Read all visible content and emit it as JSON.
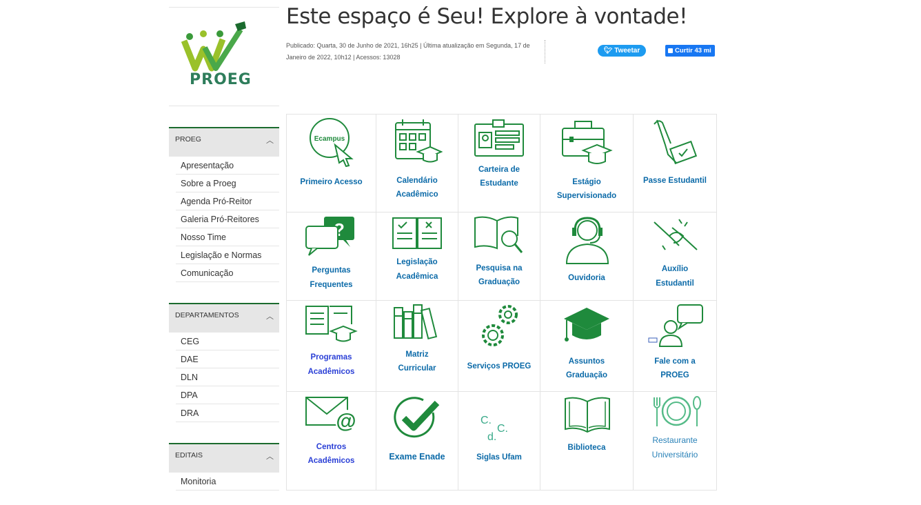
{
  "logo": {
    "text": "PROEG"
  },
  "page": {
    "title": "Este espaço é Seu! Explore à vontade!",
    "meta_line1": "Publicado: Quarta, 30 de Junho de 2021, 16h25 | Última atualização em Segunda, 17 de",
    "meta_line2": "Janeiro de 2022, 10h12 | Acessos: 13028"
  },
  "social": {
    "tweet": "Tweetar",
    "like": "Curtir 43 mi"
  },
  "sidebar": {
    "sections": [
      {
        "title": "PROEG",
        "items": [
          "Apresentação",
          "Sobre a Proeg",
          "Agenda Pró-Reitor",
          "Galeria Pró-Reitores",
          "Nosso Time",
          "Legislação e Normas",
          "Comunicação"
        ]
      },
      {
        "title": "DEPARTAMENTOS",
        "items": [
          "CEG",
          "DAE",
          "DLN",
          "DPA",
          "DRA"
        ]
      },
      {
        "title": "EDITAIS",
        "items": [
          "Monitoria"
        ]
      }
    ]
  },
  "tiles": {
    "primeiro_acesso": {
      "line1": "Primeiro Acesso",
      "icon_text": "Ecampus"
    },
    "calendario": {
      "line1": "Calendário",
      "line2": "Acadêmico"
    },
    "carteira": {
      "line1": "Carteira de",
      "line2": "Estudante"
    },
    "estagio": {
      "line1": "Estágio",
      "line2": "Supervisionado"
    },
    "passe": {
      "line1": "Passe Estudantil"
    },
    "perguntas": {
      "line1": "Perguntas",
      "line2": "Frequentes"
    },
    "legislacao": {
      "line1": "Legislação",
      "line2": "Acadêmica"
    },
    "pesquisa": {
      "line1": "Pesquisa na",
      "line2": "Graduação"
    },
    "ouvidoria": {
      "line1": "Ouvidoria"
    },
    "auxilio": {
      "line1": "Auxílio",
      "line2": "Estudantil"
    },
    "programas": {
      "line1": "Programas",
      "line2": "Acadêmicos"
    },
    "matriz": {
      "line1": "Matriz",
      "line2": "Curricular"
    },
    "servicos": {
      "line1": "Serviços PROEG"
    },
    "assuntos": {
      "line1": "Assuntos",
      "line2": "Graduação"
    },
    "fale": {
      "line1": "Fale com a",
      "line2": "PROEG"
    },
    "centros": {
      "line1": "Centros",
      "line2": "Acadêmicos"
    },
    "enade": {
      "line1": "Exame Enade"
    },
    "siglas": {
      "line1": "Siglas Ufam"
    },
    "biblioteca": {
      "line1": "Biblioteca"
    },
    "restaurante": {
      "line1": "Restaurante",
      "line2": "Universitário"
    }
  },
  "colors": {
    "green": "#1f8a3c",
    "label_blue": "#0b6aa8",
    "label_royal": "#2a3fd6",
    "section_border": "#1b6b2e"
  }
}
